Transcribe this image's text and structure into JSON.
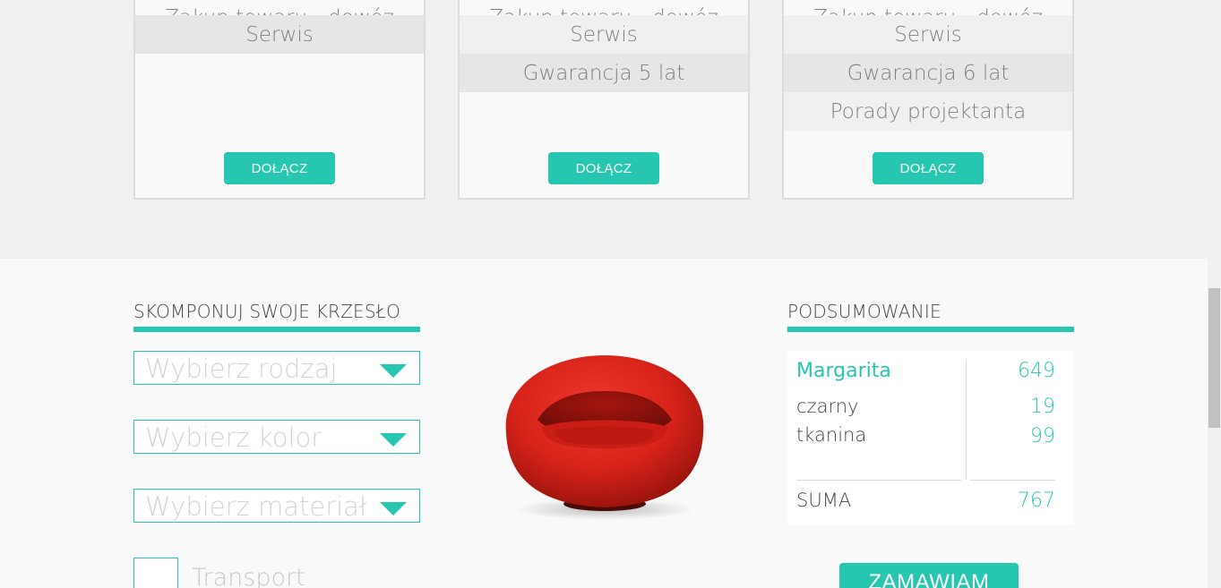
{
  "plans": [
    {
      "rows": [
        {
          "text": "Zakup towaru - dowóz",
          "style": "cut"
        },
        {
          "text": "Serwis",
          "style": "dark"
        }
      ],
      "button": "DOŁĄCZ"
    },
    {
      "rows": [
        {
          "text": "Zakup towaru - dowóz",
          "style": "cut"
        },
        {
          "text": "Serwis",
          "style": "light"
        },
        {
          "text": "Gwarancja 5 lat",
          "style": "dark"
        }
      ],
      "button": "DOŁĄCZ"
    },
    {
      "rows": [
        {
          "text": "Zakup towaru - dowóz",
          "style": "cut"
        },
        {
          "text": "Serwis",
          "style": "light"
        },
        {
          "text": "Gwarancja 6 lat",
          "style": "dark"
        },
        {
          "text": "Porady projektanta",
          "style": "light"
        }
      ],
      "button": "DOŁĄCZ"
    }
  ],
  "configurator": {
    "title": "SKOMPONUJ SWOJE KRZESŁO",
    "select_type": "Wybierz rodzaj",
    "select_color": "Wybierz kolor",
    "select_material": "Wybierz materiał",
    "transport_label": "Transport"
  },
  "summary": {
    "title": "PODSUMOWANIE",
    "name": "Margarita",
    "name_price": "649",
    "color": "czarny",
    "color_price": "19",
    "material": "tkanina",
    "material_price": "99",
    "total_label": "SUMA",
    "total_value": "767"
  },
  "order_button": "ZAMAWIAM",
  "colors": {
    "accent": "#26c6b0",
    "chair": "#e0241b"
  }
}
